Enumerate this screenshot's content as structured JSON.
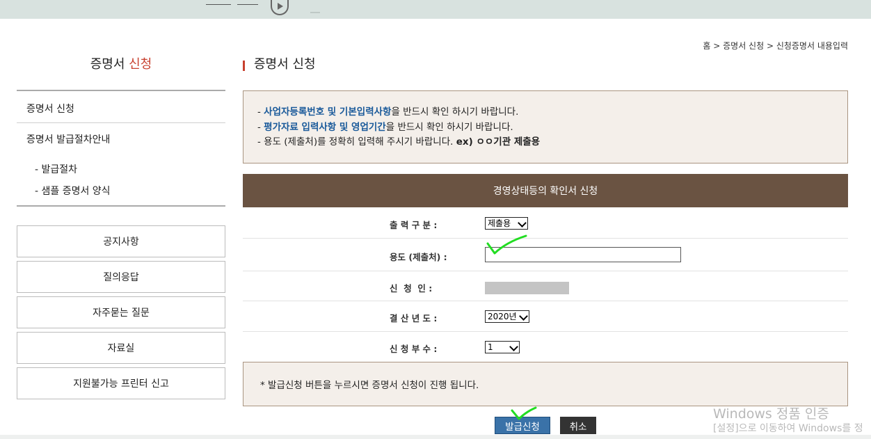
{
  "breadcrumb": "홈 > 증명서 신청 > 신청증명서 내용입력",
  "sidebar": {
    "title_prefix": "증명서 ",
    "title_highlight": "신청",
    "items": [
      {
        "label": "증명서 신청"
      },
      {
        "label": "증명서 발급절차안내"
      }
    ],
    "subitems": [
      {
        "label": "- 발급절차"
      },
      {
        "label": "- 샘플 증명서 양식"
      }
    ],
    "buttons": [
      {
        "label": "공지사항"
      },
      {
        "label": "질의응답"
      },
      {
        "label": "자주묻는 질문"
      },
      {
        "label": "자료실"
      },
      {
        "label": "지원불가능 프린터 신고"
      }
    ]
  },
  "main": {
    "title": "증명서 신청",
    "notice": {
      "line1_prefix": "- ",
      "line1_em": "사업자등록번호 및 기본입력사항",
      "line1_rest": "을 반드시 확인 하시기 바랍니다.",
      "line2_prefix": "- ",
      "line2_em": "평가자료 입력사항 및 영업기간",
      "line2_rest": "을 반드시 확인 하시기 바랍니다.",
      "line3_text": "- 용도 (제출처)를 정확히 입력해 주시기 바랍니다. ",
      "line3_bold": "ex) ㅇㅇ기관 제출용"
    },
    "form": {
      "header": "경영상태등의 확인서 신청",
      "output_type_label": "출 력 구 분 :",
      "output_type_value": "제출용",
      "purpose_label": "용도 (제출처) :",
      "purpose_value": "",
      "applicant_label": "신  청  인 :",
      "year_label": "결 산 년 도 :",
      "year_value": "2020년",
      "copies_label": "신 청 부 수 :",
      "copies_value": "1"
    },
    "info": "* 발급신청 버튼을 누르시면 증명서 신청이 진행 됩니다.",
    "issue_button": "발급신청",
    "cancel_button": "취소"
  },
  "watermark": {
    "line1": "Windows 정품 인증",
    "line2": "[설정]으로 이동하여 Windows를 정"
  },
  "colors": {
    "accent_red": "#c8402e",
    "form_header_brown": "#6a5342",
    "notice_bg": "#f4efea",
    "primary_button": "#3a72a8",
    "check_mark_green": "#22dd22"
  }
}
